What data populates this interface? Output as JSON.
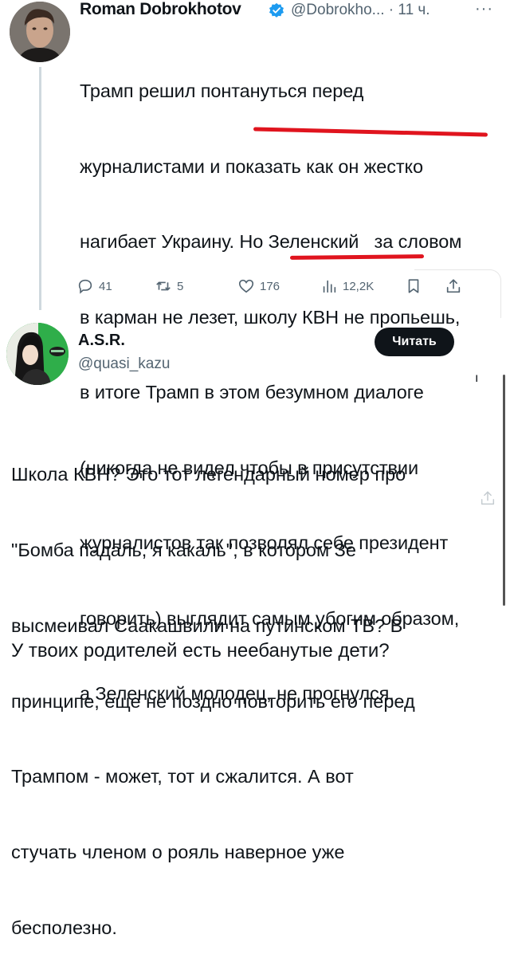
{
  "tweet": {
    "author_name": "Roman Dobrokhotov",
    "author_handle": "@Dobrokho...",
    "separator": "·",
    "time": "11 ч.",
    "more": "···",
    "lines": [
      "Трамп решил понтануться перед",
      "журналистами и показать как он жестко",
      "нагибает Украину. Но Зеленский   за словом",
      "в карман не лезет, школу КВН не пропьешь,",
      "в итоге Трамп в этом безумном диалоге",
      "(никогда не видел чтобы в присутствии",
      "журналистов так позволял себе президент",
      "говорить) выглядит самым убогим образом,",
      "а Зеленский молодец, не прогнулся."
    ],
    "highlighted_phrases": [
      "школу КВН не пропьешь,",
      "не прогнулся."
    ],
    "highlight_color": "#e0141e",
    "actions": {
      "replies": "41",
      "retweets": "5",
      "likes": "176",
      "views": "12,2K"
    }
  },
  "quoted_reply": {
    "author_name": "A.S.R.",
    "author_handle": "@quasi_kazu",
    "read_button": "Читать",
    "stray_mark": "ı",
    "lines": [
      "Школа КВН? Это тот легендарный номер про",
      "\"Бомба падаль, я какаль\", в котором Зе",
      "высмеивал Саакашвили на путинском ТВ? В",
      "принципе, еще не поздно повторить его перед",
      "Трампом - может, тот и сжалится. А вот",
      "стучать членом о рояль наверное уже",
      "бесполезно."
    ]
  },
  "final_reply": "У твоих родителей есть неебанутые дети?",
  "colors": {
    "text": "#0f1419",
    "secondary": "#536471",
    "verified_blue": "#1d9bf0",
    "button_bg": "#0f1419"
  },
  "icons": [
    "reply-icon",
    "retweet-icon",
    "like-icon",
    "views-icon",
    "bookmark-icon",
    "share-icon",
    "verified-icon"
  ]
}
